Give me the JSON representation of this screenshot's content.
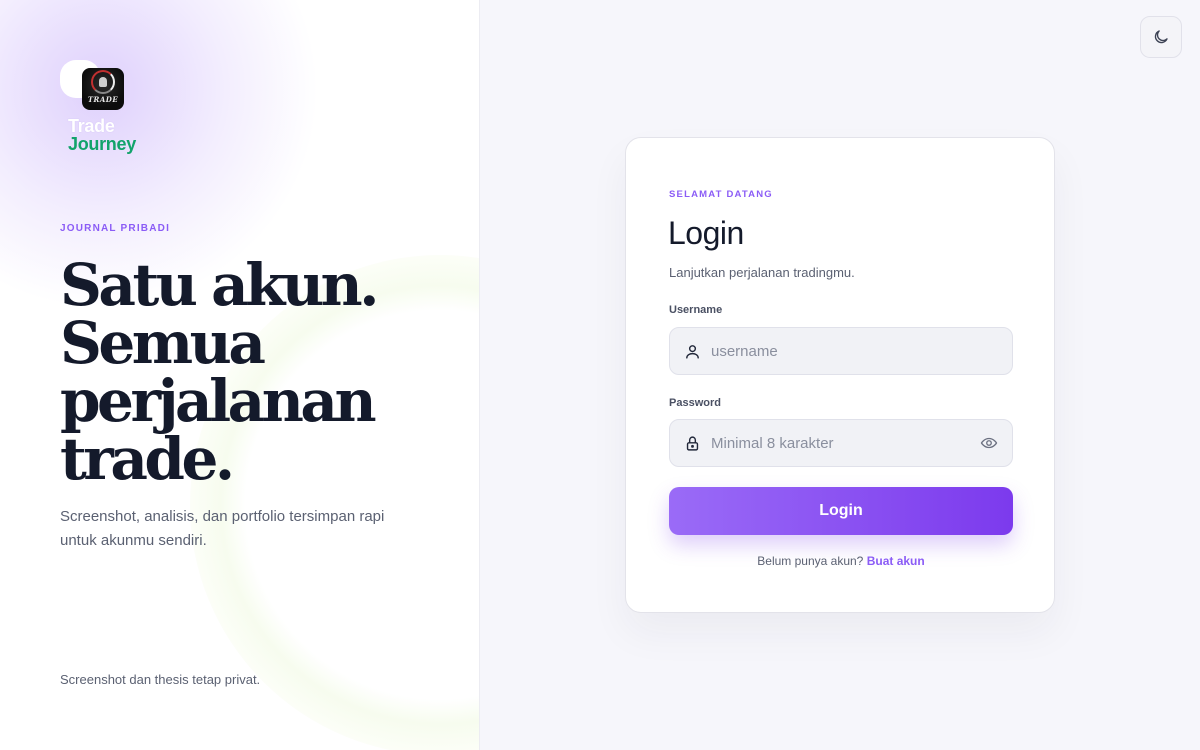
{
  "brand": {
    "logo_text": "TRADE",
    "name_line1": "Trade",
    "name_line2": "Journey",
    "colors": {
      "name_line2": "#12a36b",
      "accent": "#8b5cf6",
      "button_start": "#9a6bf7",
      "button_end": "#7c3aed"
    }
  },
  "hero": {
    "eyebrow": "JOURNAL PRIBADI",
    "headline_lines": [
      "Satu akun.",
      "Semua",
      "perjalanan",
      "trade."
    ],
    "subtext": "Screenshot, analisis, dan portfolio tersimpan rapi untuk akunmu sendiri.",
    "footnote": "Screenshot dan thesis tetap privat."
  },
  "theme_toggle": {
    "icon": "moon-icon"
  },
  "login_card": {
    "eyebrow": "SELAMAT DATANG",
    "title": "Login",
    "lead": "Lanjutkan perjalanan tradingmu.",
    "username": {
      "label": "Username",
      "placeholder": "username",
      "value": "",
      "icon": "user-icon"
    },
    "password": {
      "label": "Password",
      "placeholder": "Minimal 8 karakter",
      "value": "",
      "icon": "lock-icon",
      "toggle_icon": "eye-icon"
    },
    "submit_label": "Login",
    "signup_prompt": "Belum punya akun?",
    "signup_link": "Buat akun"
  }
}
